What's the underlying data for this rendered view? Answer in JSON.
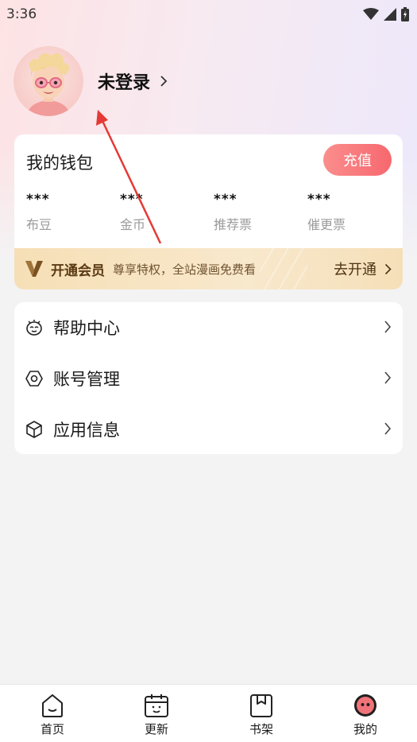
{
  "status_bar": {
    "time": "3:36",
    "icons": [
      "wifi-icon",
      "signal-icon",
      "battery-icon"
    ]
  },
  "profile": {
    "avatar_icon": "cartoon-avatar",
    "login_text": "未登录",
    "chevron": "›"
  },
  "wallet": {
    "title": "我的钱包",
    "recharge_label": "充值",
    "stats": [
      {
        "value": "***",
        "label": "布豆"
      },
      {
        "value": "***",
        "label": "金币"
      },
      {
        "value": "***",
        "label": "推荐票"
      },
      {
        "value": "***",
        "label": "催更票"
      }
    ],
    "vip": {
      "title": "开通会员",
      "description": "尊享特权，全站漫画免费看",
      "action_label": "去开通"
    }
  },
  "menu": {
    "items": [
      {
        "label": "帮助中心",
        "icon": "help-icon"
      },
      {
        "label": "账号管理",
        "icon": "account-icon"
      },
      {
        "label": "应用信息",
        "icon": "app-info-icon"
      }
    ]
  },
  "bottom_nav": {
    "items": [
      {
        "label": "首页",
        "icon": "home-icon"
      },
      {
        "label": "更新",
        "icon": "calendar-icon"
      },
      {
        "label": "书架",
        "icon": "bookshelf-icon"
      },
      {
        "label": "我的",
        "icon": "profile-icon",
        "active": true
      }
    ]
  },
  "colors": {
    "accent": "#f6686e",
    "vip_gold": "#f6dfb6",
    "annotation_arrow": "#e53935"
  }
}
